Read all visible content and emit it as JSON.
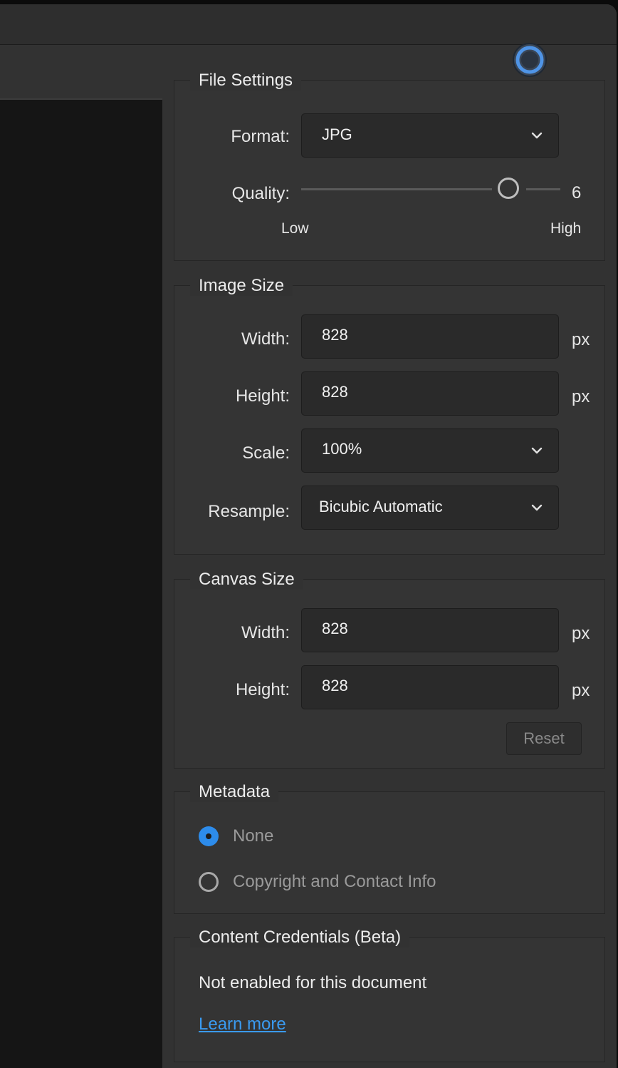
{
  "file_settings": {
    "legend": "File Settings",
    "format_label": "Format:",
    "format_value": "JPG",
    "quality_label": "Quality:",
    "quality_value": "6",
    "quality_low": "Low",
    "quality_high": "High"
  },
  "image_size": {
    "legend": "Image Size",
    "width_label": "Width:",
    "width_value": "828",
    "height_label": "Height:",
    "height_value": "828",
    "scale_label": "Scale:",
    "scale_value": "100%",
    "resample_label": "Resample:",
    "resample_value": "Bicubic Automatic",
    "unit": "px"
  },
  "canvas_size": {
    "legend": "Canvas Size",
    "width_label": "Width:",
    "width_value": "828",
    "height_label": "Height:",
    "height_value": "828",
    "unit": "px",
    "reset_label": "Reset"
  },
  "metadata": {
    "legend": "Metadata",
    "options": [
      {
        "label": "None",
        "selected": true
      },
      {
        "label": "Copyright and Contact Info",
        "selected": false
      }
    ]
  },
  "content_credentials": {
    "legend": "Content Credentials (Beta)",
    "status": "Not enabled for this document",
    "learn_more": "Learn more"
  },
  "colors": {
    "accent": "#2d8ceb",
    "link": "#3a9af0",
    "panel_bg": "#323232"
  },
  "icons": [
    "target-ring-icon",
    "chevron-down-icon"
  ]
}
